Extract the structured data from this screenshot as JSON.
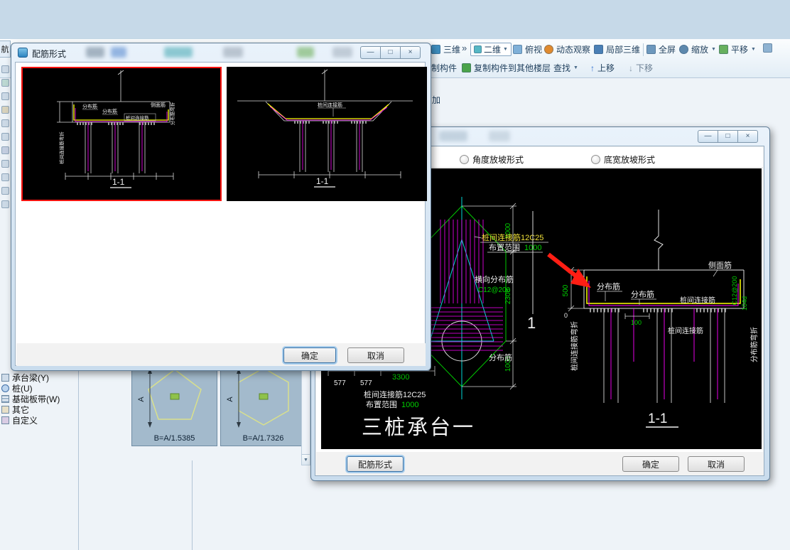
{
  "icons": {
    "dropdown": "▼",
    "overflow": "»",
    "up_arrow": "↑",
    "down_arrow": "↓",
    "minimize": "—",
    "maximize": "□",
    "close": "×",
    "scroll_down": "▼"
  },
  "toolbar": {
    "view3d": "三维",
    "view2d": "二维",
    "top_view": "俯视",
    "orbit": "动态观察",
    "local3d": "局部三维",
    "fullscreen": "全屏",
    "zoom": "缩放",
    "pan": "平移"
  },
  "toolbar2": {
    "make_component": "制构件",
    "copy_to_floors": "复制构件到其他楼层",
    "find": "查找",
    "move_up": "上移",
    "move_down": "下移",
    "partial_add": "加"
  },
  "sidebar": {
    "nav_tab": "航",
    "tree_items": [
      {
        "label": "承台梁(Y)"
      },
      {
        "label": "桩(U)"
      },
      {
        "label": "基础板带(W)"
      },
      {
        "label": "其它"
      },
      {
        "label": "自定义"
      }
    ]
  },
  "preview_list": {
    "panels": [
      {
        "dim": "A",
        "formula": "B=A/1.5385"
      },
      {
        "dim": "A",
        "formula": "B=A/1.7326"
      }
    ]
  },
  "rebar_dialog": {
    "title": "配筋形式",
    "ok": "确定",
    "cancel": "取消",
    "panel1": {
      "fenbujin_a": "分布筋",
      "fenbujin_b": "分布筋",
      "zhujian": "桩间连接筋",
      "cemianjin": "侧面筋",
      "left_rot": "桩间连接筋弯折",
      "right_rot": "分布筋弯折",
      "section": "1-1"
    },
    "panel2": {
      "zhujian": "桩间连接筋",
      "section": "1-1"
    }
  },
  "main_dialog": {
    "radio_angle": "角度放坡形式",
    "radio_width": "底宽放坡形式",
    "btn_rebar": "配筋形式",
    "ok": "确定",
    "cancel": "取消",
    "plan": {
      "label_zhujian_top": "桩间连接筋12C25",
      "label_range_top": "布置范围",
      "val_range_top": "1000",
      "label_hengxiang": "横向分布筋",
      "val_hengxiang": "C12@200",
      "label_fenbujin": "分布筋",
      "dim_577a": "577",
      "dim_577b": "577",
      "dim_3300": "3300",
      "dim_r1": "1000",
      "dim_r2": "2308",
      "dim_r3": "1000",
      "label_zhujian_bottom": "桩间连接筋12C25",
      "label_range_bottom": "布置范围",
      "val_range_bottom": "1000",
      "title": "三桩承台一",
      "section_mark": "1"
    },
    "section": {
      "fenbujin_a": "分布筋",
      "fenbujin_b": "分布筋",
      "cemianjin": "侧面筋",
      "zhujian_a": "桩间连接筋",
      "zhujian_b": "桩间连接筋",
      "left_rot": "桩间连接筋弯折",
      "rot_c12": "C12@200",
      "rot_104d": "104d",
      "right_rot": "分布筋弯折",
      "dim_500": "500",
      "dim_0": "0",
      "dim_100": "100",
      "section_label": "1-1"
    }
  }
}
